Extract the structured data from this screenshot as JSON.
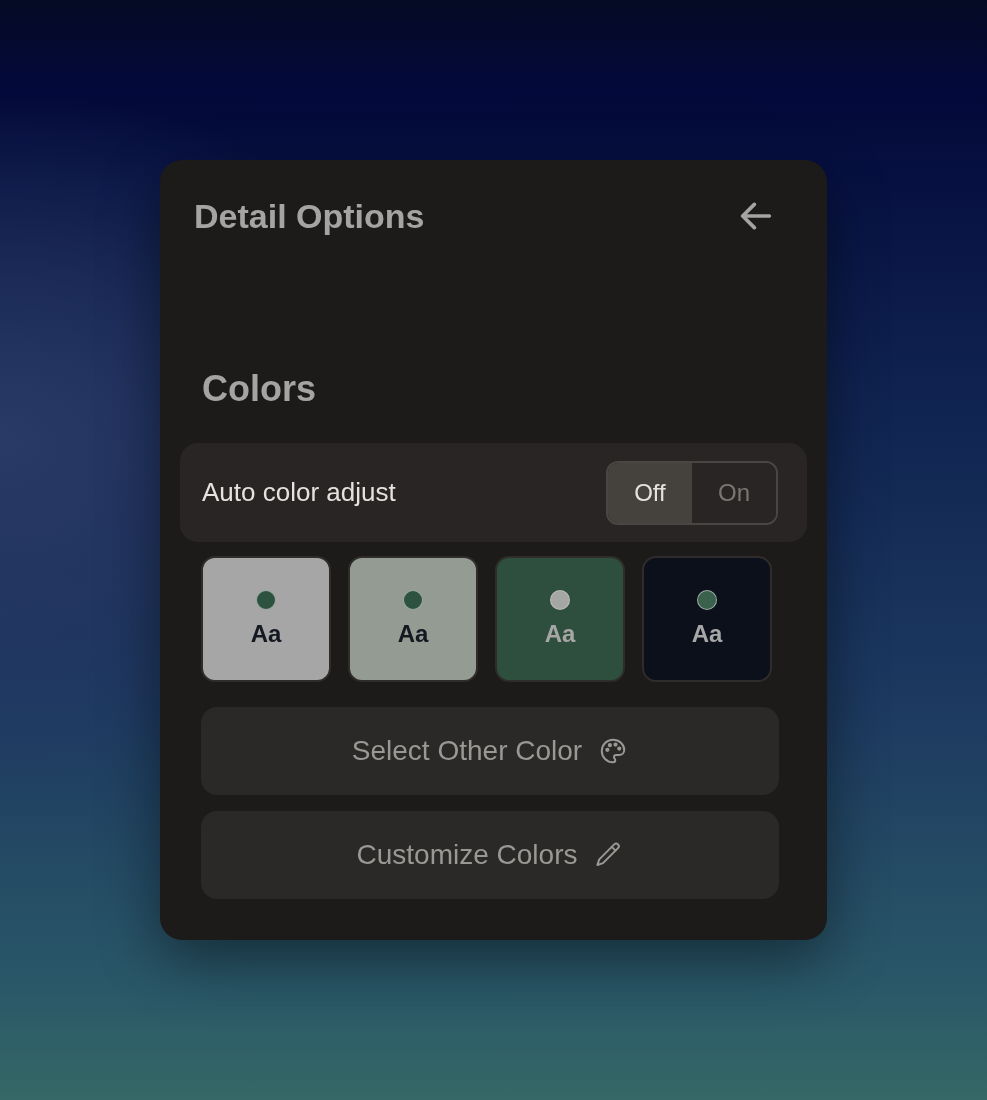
{
  "panel": {
    "title": "Detail Options"
  },
  "section": {
    "title": "Colors"
  },
  "auto_color_adjust": {
    "label": "Auto color adjust",
    "options": [
      {
        "label": "Off",
        "selected": true
      },
      {
        "label": "On",
        "selected": false
      }
    ]
  },
  "swatches": [
    {
      "label": "Aa",
      "color": "#a6a6a6",
      "dot": {
        "color": "#2e5240"
      }
    },
    {
      "label": "Aa",
      "color": "#949b93",
      "dot": {
        "color": "#2e5240"
      }
    },
    {
      "label": "Aa",
      "color": "#2e4f3d",
      "dot": {
        "color": "#a6a6a6"
      }
    },
    {
      "label": "Aa",
      "color": "#0b101b",
      "dot": {
        "color": "#3a614c"
      }
    }
  ],
  "buttons": [
    {
      "label": "Select Other Color",
      "kind": "palette"
    },
    {
      "label": "Customize Colors",
      "kind": "pencil"
    }
  ]
}
